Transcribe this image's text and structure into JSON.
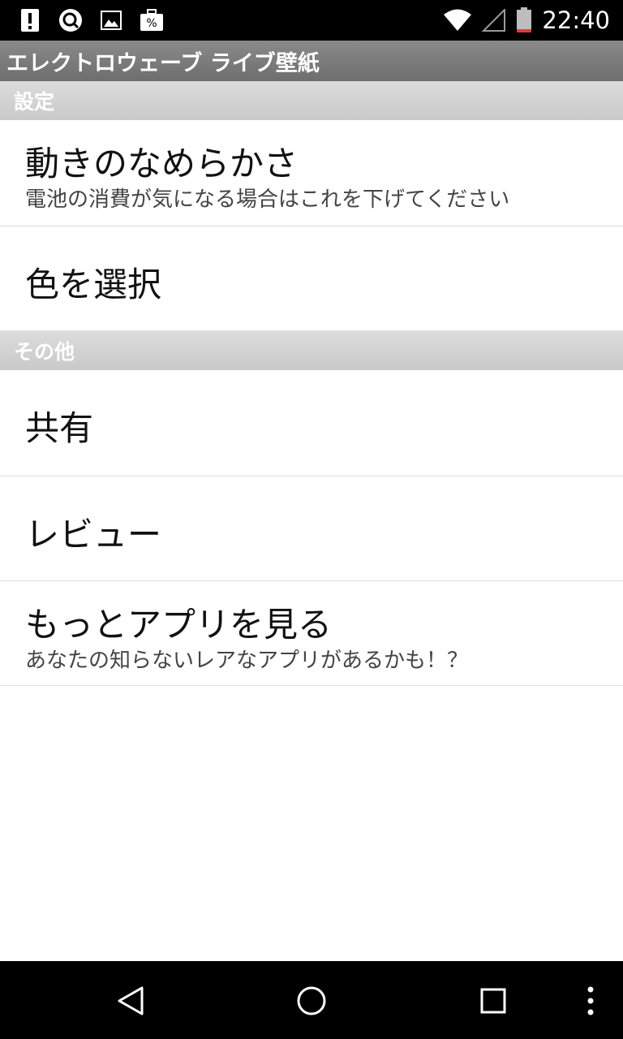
{
  "status_bar": {
    "time": "22:40",
    "left_icons": [
      "alert-icon",
      "search-notification-icon",
      "image-icon",
      "briefcase-icon"
    ],
    "right_icons": [
      "wifi-icon",
      "cell-signal-icon",
      "battery-icon"
    ]
  },
  "app_bar": {
    "title": "エレクトロウェーブ ライブ壁紙"
  },
  "sections": [
    {
      "header": "設定",
      "items": [
        {
          "title": "動きのなめらかさ",
          "summary": "電池の消費が気になる場合はこれを下げてください"
        },
        {
          "title": "色を選択"
        }
      ]
    },
    {
      "header": "その他",
      "items": [
        {
          "title": "共有"
        },
        {
          "title": "レビュー"
        },
        {
          "title": "もっとアプリを見る",
          "summary": "あなたの知らないレアなアプリがあるかも！？"
        }
      ]
    }
  ],
  "nav_bar": {
    "buttons": [
      "back-icon",
      "home-icon",
      "recents-icon",
      "overflow-menu-icon"
    ]
  },
  "colors": {
    "status_bar_bg": "#000000",
    "title_bar_bg": "#7a7a7a",
    "section_header_bg": "#d3d3d3",
    "battery_accent": "#e53935"
  }
}
